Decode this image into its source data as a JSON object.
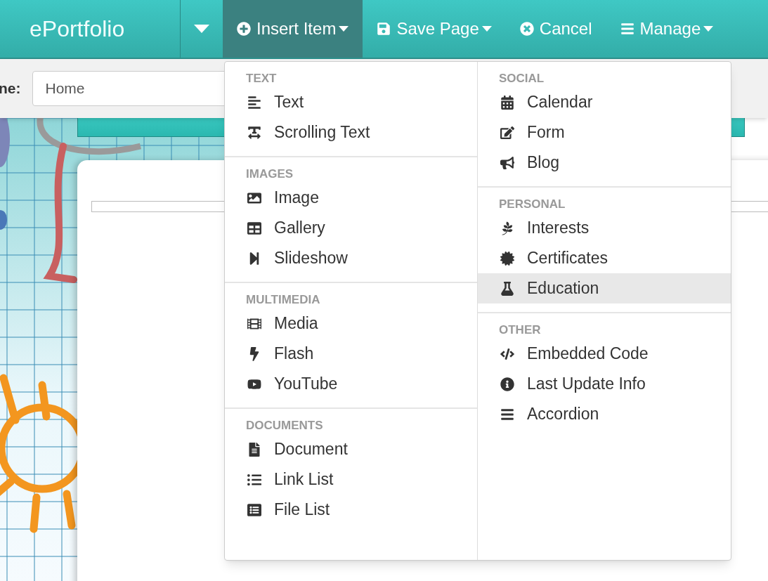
{
  "navbar": {
    "brand": "ePortfolio",
    "items": [
      {
        "label": "Insert Item",
        "caret": true,
        "selected": true
      },
      {
        "label": "Save Page",
        "caret": true,
        "selected": false
      },
      {
        "label": "Cancel",
        "caret": false,
        "selected": false
      },
      {
        "label": "Manage",
        "caret": true,
        "selected": false
      }
    ]
  },
  "page_name": {
    "label": "ne:",
    "value": "Home"
  },
  "insert_menu": {
    "columns": [
      [
        {
          "heading": "TEXT",
          "items": [
            {
              "label": "Text",
              "selected": false
            },
            {
              "label": "Scrolling Text",
              "selected": false
            }
          ]
        },
        {
          "heading": "IMAGES",
          "items": [
            {
              "label": "Image",
              "selected": false
            },
            {
              "label": "Gallery",
              "selected": false
            },
            {
              "label": "Slideshow",
              "selected": false
            }
          ]
        },
        {
          "heading": "MULTIMEDIA",
          "items": [
            {
              "label": "Media",
              "selected": false
            },
            {
              "label": "Flash",
              "selected": false
            },
            {
              "label": "YouTube",
              "selected": false
            }
          ]
        },
        {
          "heading": "DOCUMENTS",
          "items": [
            {
              "label": "Document",
              "selected": false
            },
            {
              "label": "Link List",
              "selected": false
            },
            {
              "label": "File List",
              "selected": false
            }
          ]
        }
      ],
      [
        {
          "heading": "SOCIAL",
          "items": [
            {
              "label": "Calendar",
              "selected": false
            },
            {
              "label": "Form",
              "selected": false
            },
            {
              "label": "Blog",
              "selected": false
            }
          ]
        },
        {
          "heading": "PERSONAL",
          "items": [
            {
              "label": "Interests",
              "selected": false
            },
            {
              "label": "Certificates",
              "selected": false
            },
            {
              "label": "Education",
              "selected": true
            }
          ]
        },
        {
          "heading": "OTHER",
          "items": [
            {
              "label": "Embedded Code",
              "selected": false
            },
            {
              "label": "Last Update Info",
              "selected": false
            },
            {
              "label": "Accordion",
              "selected": false
            }
          ]
        }
      ]
    ]
  }
}
